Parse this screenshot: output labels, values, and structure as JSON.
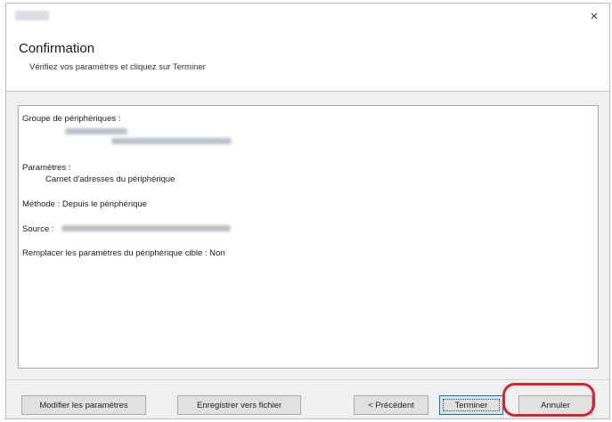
{
  "window": {
    "close_glyph": "×"
  },
  "header": {
    "title": "Confirmation",
    "subtitle": "Vérifiez vos paramètres et cliquez sur Terminer"
  },
  "summary": {
    "group_label": "Groupe de périphériques :",
    "params_label": "Paramètres :",
    "params_value": "Carnet d'adresses du périphérique",
    "method_line": "Méthode : Depuis le périphérique",
    "source_label": "Source :",
    "replace_line": "Remplacer les paramètres du périphérique cible : Non"
  },
  "buttons": {
    "modify": "Modifier les paramètres",
    "save": "Enregistrer vers fichier",
    "previous": "< Précédent",
    "finish": "Terminer",
    "cancel": "Annuler"
  },
  "annotation": {
    "highlight_color": "#d9232e"
  }
}
